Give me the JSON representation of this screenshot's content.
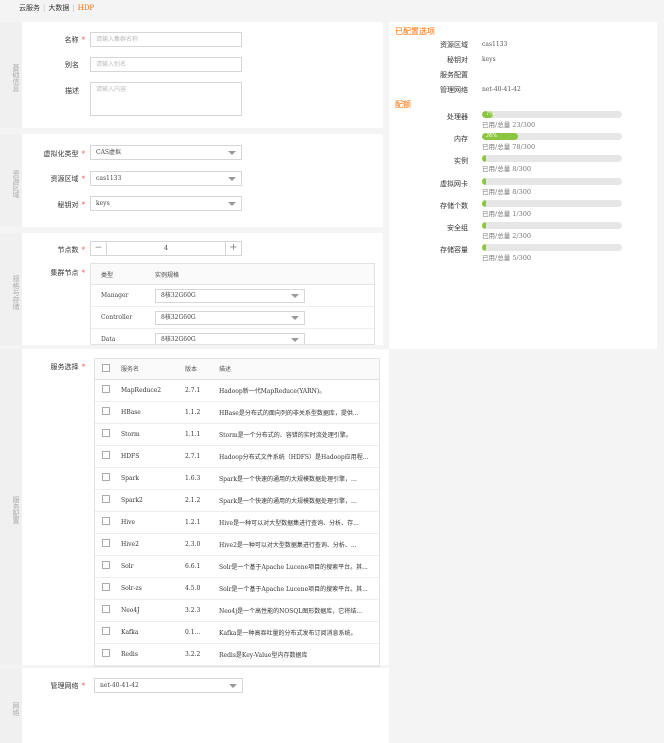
{
  "breadcrumb": {
    "items": [
      "云服务",
      "大数据",
      "HDP"
    ]
  },
  "basic": {
    "section": "基础信息",
    "name_label": "名称",
    "name_placeholder": "请输入集群名称",
    "alias_label": "别名",
    "alias_placeholder": "请输入别名",
    "desc_label": "描述",
    "desc_placeholder": "请输入内容"
  },
  "resource": {
    "section": "资源区域",
    "virt_label": "虚拟化类型",
    "virt_value": "CAS虚拟",
    "zone_label": "资源区域",
    "zone_value": "cas1133",
    "key_label": "秘钥对",
    "key_value": "keys"
  },
  "spec": {
    "section": "规格与存储",
    "nodes_label": "节点数",
    "nodes_value": "4",
    "minus": "−",
    "plus": "+",
    "cluster_label": "集群节点",
    "col_type": "类型",
    "col_spec": "实例规格",
    "rows": [
      {
        "type": "Manager",
        "spec": "8核32G60G"
      },
      {
        "type": "Controller",
        "spec": "8核32G60G"
      },
      {
        "type": "Data",
        "spec": "8核32G60G"
      }
    ]
  },
  "service": {
    "section": "服务配置",
    "select_label": "服务选择",
    "col_name": "服务名",
    "col_version": "版本",
    "col_desc": "描述",
    "rows": [
      {
        "name": "MapReduce2",
        "version": "2.7.1",
        "desc": "Hadoop新一代MapReduce(YARN)。"
      },
      {
        "name": "HBase",
        "version": "1.1.2",
        "desc": "HBase是分布式的面向列的非关系型数据库，提供..."
      },
      {
        "name": "Storm",
        "version": "1.1.1",
        "desc": "Storm是一个分布式的、容错的实时流处理引擎。"
      },
      {
        "name": "HDFS",
        "version": "2.7.1",
        "desc": "Hadoop分布式文件系统（HDFS）是Hadoop应用程..."
      },
      {
        "name": "Spark",
        "version": "1.6.3",
        "desc": "Spark是一个快速的通用的大规模数据处理引擎，..."
      },
      {
        "name": "Spark2",
        "version": "2.1.2",
        "desc": "Spark是一个快速的通用的大规模数据处理引擎，..."
      },
      {
        "name": "Hive",
        "version": "1.2.1",
        "desc": "Hive是一种可以对大型数据集进行查询、分析、存..."
      },
      {
        "name": "Hive2",
        "version": "2.3.0",
        "desc": "Hive2是一种可以对大型数据集进行查询、分析、..."
      },
      {
        "name": "Solr",
        "version": "6.6.1",
        "desc": "Solr是一个基于Apache Lucene项目的搜索平台。其..."
      },
      {
        "name": "Solr-zs",
        "version": "4.5.0",
        "desc": "Solr是一个基于Apache Lucene项目的搜索平台。其..."
      },
      {
        "name": "Neo4J",
        "version": "3.2.3",
        "desc": "Neo4j是一个高性能的NOSQL图形数据库，它将结..."
      },
      {
        "name": "Kafka",
        "version": "0.1...",
        "desc": "Kafka是一种高吞吐量的分布式发布订阅消息系统。"
      },
      {
        "name": "Redis",
        "version": "3.2.2",
        "desc": "Redis是Key-Value型内存数据库"
      }
    ]
  },
  "network": {
    "section": "网络",
    "label": "管理网络",
    "value": "net-40-41-42"
  },
  "summary": {
    "title": "已配置选项",
    "items": [
      {
        "k": "资源区域",
        "v": "cas1133"
      },
      {
        "k": "秘钥对",
        "v": "keys"
      },
      {
        "k": "服务配置",
        "v": ""
      },
      {
        "k": "管理网络",
        "v": "net-40-41-42"
      }
    ],
    "quota_title": "配额",
    "quotas": [
      {
        "k": "处理器",
        "pct_label": "7%",
        "used": "已用/总量 23/300",
        "fraction": 0.077
      },
      {
        "k": "内存",
        "pct_label": "26%",
        "used": "已用/总量 78/300",
        "fraction": 0.26
      },
      {
        "k": "实例",
        "pct_label": "",
        "used": "已用/总量 8/300",
        "fraction": 0.027
      },
      {
        "k": "虚拟网卡",
        "pct_label": "",
        "used": "已用/总量 8/300",
        "fraction": 0.027
      },
      {
        "k": "存储个数",
        "pct_label": "",
        "used": "已用/总量 1/300",
        "fraction": 0.003
      },
      {
        "k": "安全组",
        "pct_label": "",
        "used": "已用/总量 2/300",
        "fraction": 0.007
      },
      {
        "k": "存储容量",
        "pct_label": "",
        "used": "已用/总量 5/300",
        "fraction": 0.017
      }
    ]
  },
  "colors": {
    "accent": "#ff6a00",
    "bar": "#8cc63f",
    "required": "#ff4d4f"
  }
}
